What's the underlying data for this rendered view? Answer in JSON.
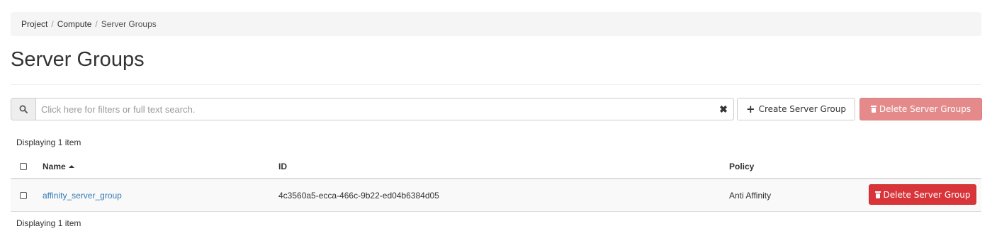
{
  "breadcrumb": {
    "items": [
      "Project",
      "Compute",
      "Server Groups"
    ],
    "separator": "/"
  },
  "page": {
    "title": "Server Groups"
  },
  "search": {
    "placeholder": "Click here for filters or full text search.",
    "value": "",
    "clear_glyph": "✖"
  },
  "actions": {
    "create_label": "Create Server Group",
    "delete_multi_label": "Delete Server Groups"
  },
  "table": {
    "count_top": "Displaying 1 item",
    "count_bottom": "Displaying 1 item",
    "columns": {
      "name": "Name",
      "id": "ID",
      "policy": "Policy"
    },
    "sort": {
      "column": "Name",
      "direction": "ascending"
    },
    "rows": [
      {
        "name": "affinity_server_group",
        "id": "4c3560a5-ecca-466c-9b22-ed04b6384d05",
        "policy": "Anti Affinity",
        "action_label": "Delete Server Group"
      }
    ]
  },
  "colors": {
    "link": "#337ab7",
    "danger": "#d9343a",
    "danger_disabled": "#e58a8a",
    "breadcrumb_bg": "#f5f5f5"
  },
  "icons": {
    "search": "search-icon",
    "clear": "clear-icon",
    "create": "plus-icon",
    "delete": "trash-icon",
    "sort": "sort-ascending-icon"
  }
}
